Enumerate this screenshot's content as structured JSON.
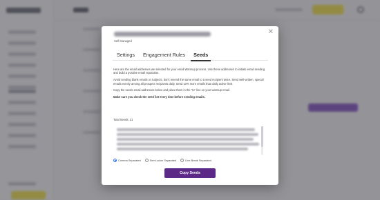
{
  "modal": {
    "managed_label": "Self Managed",
    "close_glyph": "✕",
    "tabs": [
      {
        "label": "Settings",
        "active": false
      },
      {
        "label": "Engagement Rules",
        "active": false
      },
      {
        "label": "Seeds",
        "active": true
      }
    ],
    "paragraphs": [
      "Here are the email addresses we selected for your email Warmup process. Use these addresses to initiate email sending and build a positive email reputation.",
      "Avoid sending blank emails or subjects, don't resend the same email to a seed recipient twice. Send well-written, special emails evenly among all prospect recipients daily. Send 10% more emails than daily active limit.",
      "Copy the seeds email addresses below and place them in the \"to\" line on your warmup email.",
      "Make sure you check the seed list every time before sending emails."
    ],
    "total_label": "Total Seeds: 21",
    "radio_options": [
      {
        "label": "Comma Separated",
        "selected": true
      },
      {
        "label": "Semi-colon Separated",
        "selected": false
      },
      {
        "label": "Line Break Separated",
        "selected": false
      }
    ],
    "copy_button": "Copy Seeds"
  },
  "colors": {
    "primary_button": "#5c2a86",
    "radio_selected": "#3b6fd8",
    "accent_yellow": "#f2e45c"
  },
  "icons": {
    "close": "close-icon",
    "settings": "gear-icon"
  }
}
